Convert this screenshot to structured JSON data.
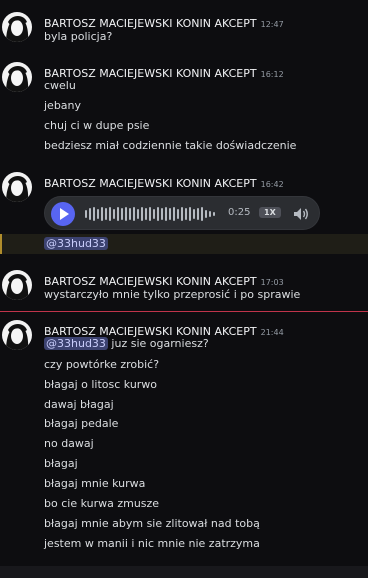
{
  "messages": [
    {
      "author": "BARTOSZ MACIEJEWSKI KONIN AKCEPT",
      "time": "12:47",
      "lines": [
        "byla policja?"
      ]
    },
    {
      "author": "BARTOSZ MACIEJEWSKI KONIN AKCEPT",
      "time": "16:12",
      "lines": [
        "cwelu",
        "jebany",
        "chuj ci w dupe psie",
        "bedziesz miał codziennie takie doświadczenie"
      ]
    },
    {
      "author": "BARTOSZ MACIEJEWSKI KONIN AKCEPT",
      "time": "16:42",
      "voice": {
        "duration": "0:25",
        "speed": "1X",
        "play_icon": "play-icon",
        "volume_icon": "volume-icon"
      },
      "mention_line": "@33hud33"
    },
    {
      "author": "BARTOSZ MACIEJEWSKI KONIN AKCEPT",
      "time": "17:03",
      "lines": [
        "wystarczyło mnie tylko przeprosić i po sprawie"
      ]
    },
    {
      "author": "BARTOSZ MACIEJEWSKI KONIN AKCEPT",
      "time": "21:44",
      "first_mention": "@33hud33",
      "first_text": " juz sie ogarniesz?",
      "lines": [
        "czy powtórke zrobić?",
        "błagaj o litosc kurwo",
        "dawaj błagaj",
        "błagaj pedale",
        "no dawaj",
        "błagaj",
        "błagaj mnie kurwa",
        "bo cie kurwa zmusze",
        "błagaj mnie abym sie zlitował nad tobą",
        "jestem w manii i nic mnie nie zatrzyma"
      ]
    }
  ],
  "colors": {
    "background": "#0d0d10",
    "mention_bg": "#3c4270",
    "mention_text": "#c9cdfb",
    "accent": "#5865f2",
    "new_divider": "#c0344b",
    "highlight_border": "#b08d2c"
  }
}
